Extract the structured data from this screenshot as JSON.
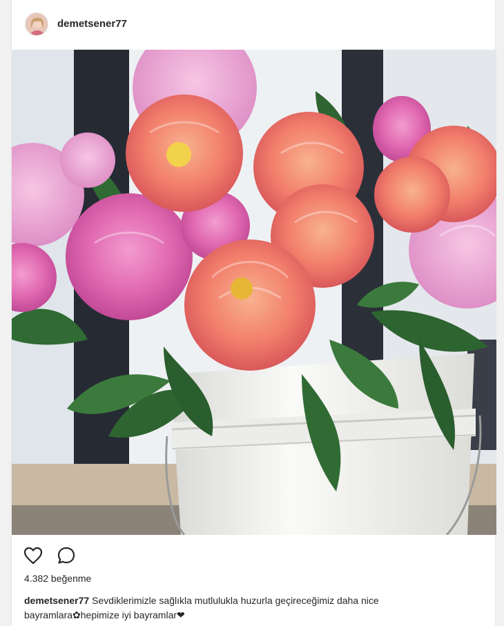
{
  "post": {
    "username": "demetsener77",
    "likes_text": "4.382 beğenme",
    "caption_user": "demetsener77",
    "caption_text": "Sevdiklerimizle sağlıkla mutlulukla huzurla geçireceğimiz daha nice bayramlara✿hepimize iyi bayramlar❤"
  },
  "icons": {
    "like": "heart-outline-icon",
    "comment": "comment-bubble-icon"
  },
  "colors": {
    "text": "#262626",
    "pink_peony": "#e36fb4",
    "coral_peony": "#f0806e",
    "leaf": "#2f6b33",
    "bucket": "#f4f4f2"
  }
}
